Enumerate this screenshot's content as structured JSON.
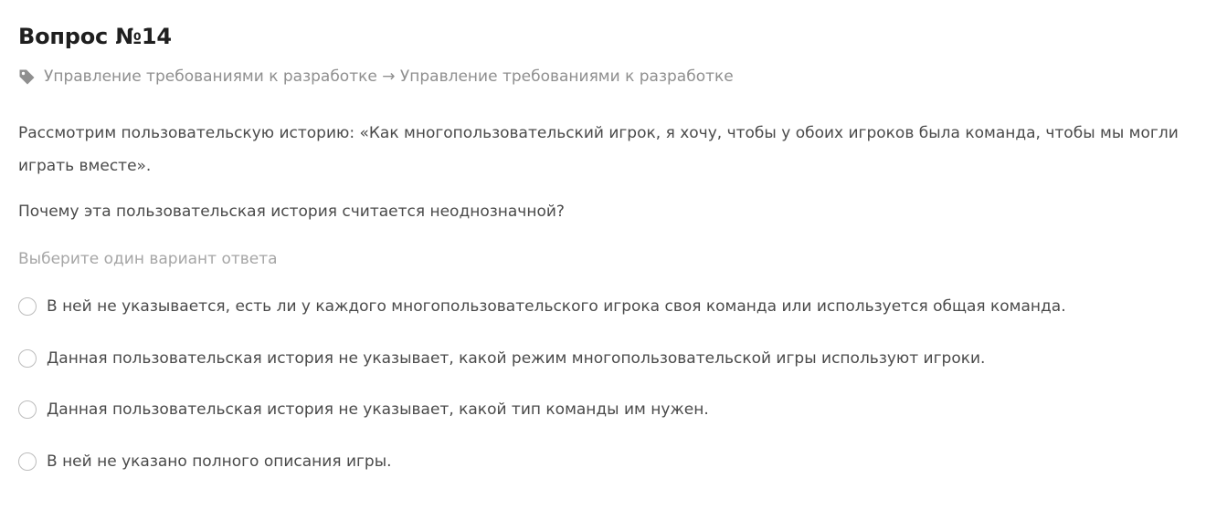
{
  "header": {
    "title": "Вопрос №14"
  },
  "breadcrumb": {
    "icon": "tag-icon",
    "text": "Управление требованиями к разработке → Управление требованиями к разработке"
  },
  "question": {
    "story": "Рассмотрим пользовательскую историю: «Как многопользовательский игрок, я хочу, чтобы у обоих игроков была команда, чтобы мы могли играть вместе».",
    "prompt": "Почему эта пользовательская история считается неоднозначной?",
    "hint": "Выберите один вариант ответа"
  },
  "options": [
    {
      "label": "В ней не указывается, есть ли у каждого многопользовательского игрока своя команда или используется общая команда.",
      "selected": false
    },
    {
      "label": "Данная пользовательская история не указывает, какой режим многопользовательской игры используют игроки.",
      "selected": false
    },
    {
      "label": "Данная пользовательская история не указывает, какой тип команды им нужен.",
      "selected": false
    },
    {
      "label": "В ней не указано полного описания игры.",
      "selected": false
    }
  ]
}
